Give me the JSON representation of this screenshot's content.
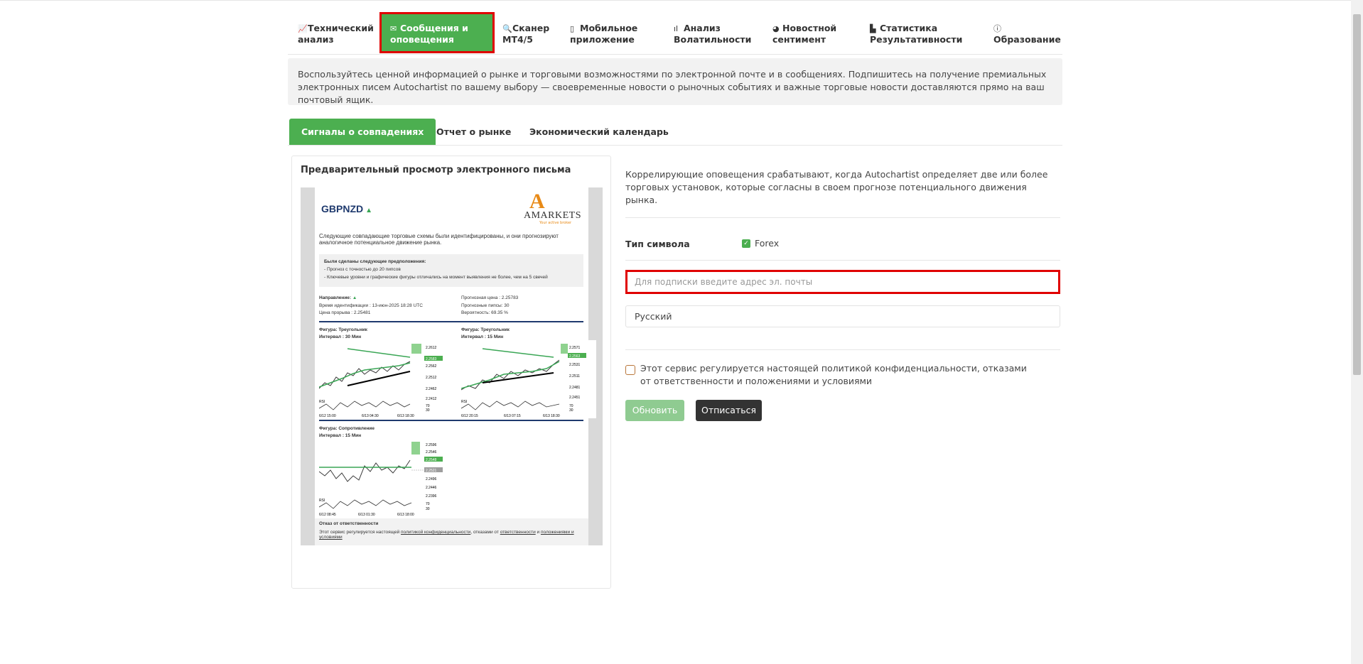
{
  "nav": {
    "items": [
      {
        "icon": "line-chart-icon",
        "label": "Технический анализ",
        "glyph": "📈"
      },
      {
        "icon": "envelope-icon",
        "label": "Сообщения и оповещения",
        "glyph": "✉"
      },
      {
        "icon": "search-icon",
        "label": "Сканер MT4/5",
        "glyph": "🔍"
      },
      {
        "icon": "mobile-icon",
        "label": "Мобильное приложение",
        "glyph": "▯"
      },
      {
        "icon": "volatility-icon",
        "label": "Анализ Волатильности",
        "glyph": "ıl"
      },
      {
        "icon": "gauge-icon",
        "label": "Новостной сентимент",
        "glyph": "◕"
      },
      {
        "icon": "bar-chart-icon",
        "label": "Статистика Результативности",
        "glyph": "▙"
      },
      {
        "icon": "info-icon",
        "label": "Образование",
        "glyph": "ⓘ"
      }
    ],
    "active_index": 1
  },
  "info_text": "Воспользуйтесь ценной информацией о рынке и торговыми возможностями по электронной почте и в сообщениях. Подпишитесь на получение премиальных электронных писем Autochartist по вашему выбору — своевременные новости о рыночных событиях и важные торговые новости доставляются прямо на ваш почтовый ящик.",
  "tabs": [
    {
      "label": "Сигналы о совпадениях"
    },
    {
      "label": "Отчет о рынке"
    },
    {
      "label": "Экономический календарь"
    }
  ],
  "preview": {
    "title": "Предварительный просмотр электронного письма",
    "pair": "GBPNZD",
    "logo_text": "AMARKETS",
    "logo_sub": "Your active broker",
    "intro": "Следующие совпадающие торговые схемы были идентифицированы, и они прогнозируют аналогичное потенциальное движение рынка.",
    "assumptions_title": "Были сделаны следующие предположения:",
    "assumption_1": "- Прогноз с точностью до 20 пипсов",
    "assumption_2": "- Ключевые уровни и графические фигуры отличались на момент выявления не более, чем на 5 свечей",
    "direction": "Направление:",
    "ident_time": "Время идентификации : 13-июн-2025 18:28 UTC",
    "breakout": "Цена прорыва : 2.25481",
    "forecast_price": "Прогнозная цена : 2.25783",
    "forecast_pips": "Прогнозные пипсы: 30",
    "probability": "Вероятность: 69.35 %",
    "chart1_label": "Фигура: Треугольник",
    "chart1_interval": "Интервал : 30 Мин",
    "chart2_label": "Фигура: Треугольник",
    "chart2_interval": "Интервал : 15 Мин",
    "chart3_label": "Фигура: Сопротивление",
    "chart3_interval": "Интервал : 15 Мин",
    "c1_dates": [
      "6/12 15:00",
      "6/13 04:30",
      "6/13 18:30"
    ],
    "c2_dates": [
      "6/12 20:15",
      "6/13 07:15",
      "6/13 18:30"
    ],
    "c3_dates": [
      "6/12 08:45",
      "6/13 01:30",
      "6/13 18:00"
    ],
    "rsi_label": "RSI",
    "c1_ticks": [
      "2.2612",
      "2.2583",
      "2.2562",
      "2.2512",
      "2.2462",
      "2.2412",
      "70",
      "30"
    ],
    "c2_ticks": [
      "2.2571",
      "2.2563",
      "2.2531",
      "2.2511",
      "2.2481",
      "2.2451",
      "70",
      "30"
    ],
    "c3_ticks": [
      "2.2596",
      "2.2546",
      "2.2548",
      "2.2521",
      "2.2496",
      "2.2446",
      "2.2396",
      "70",
      "30"
    ],
    "disclaimer_title": "Отказ от ответственности",
    "disclaimer_pre": "Этот сервис регулируется настоящей ",
    "disclaimer_link1": "политикой конфиденциальности",
    "disclaimer_mid": ", отказами от ",
    "disclaimer_link2": "ответственности",
    "disclaimer_and": " и ",
    "disclaimer_link3": "положениями и условиями"
  },
  "form": {
    "description": "Коррелирующие оповещения срабатывают, когда Autochartist определяет две или более торговых установок, которые согласны в своем прогнозе потенциального движения рынка.",
    "symbol_type_label": "Тип символа",
    "forex_label": "Forex",
    "email_placeholder": "Для подписки введите адрес эл. почты",
    "language": "Русский",
    "policy_text": "Этот сервис регулируется настоящей политикой конфиденциальности, отказами от ответственности и положениями и условиями",
    "update_button": "Обновить",
    "unsubscribe_button": "Отписаться"
  },
  "colors": {
    "accent": "#4caf50",
    "highlight": "#e00000",
    "dark_button": "#333333"
  }
}
